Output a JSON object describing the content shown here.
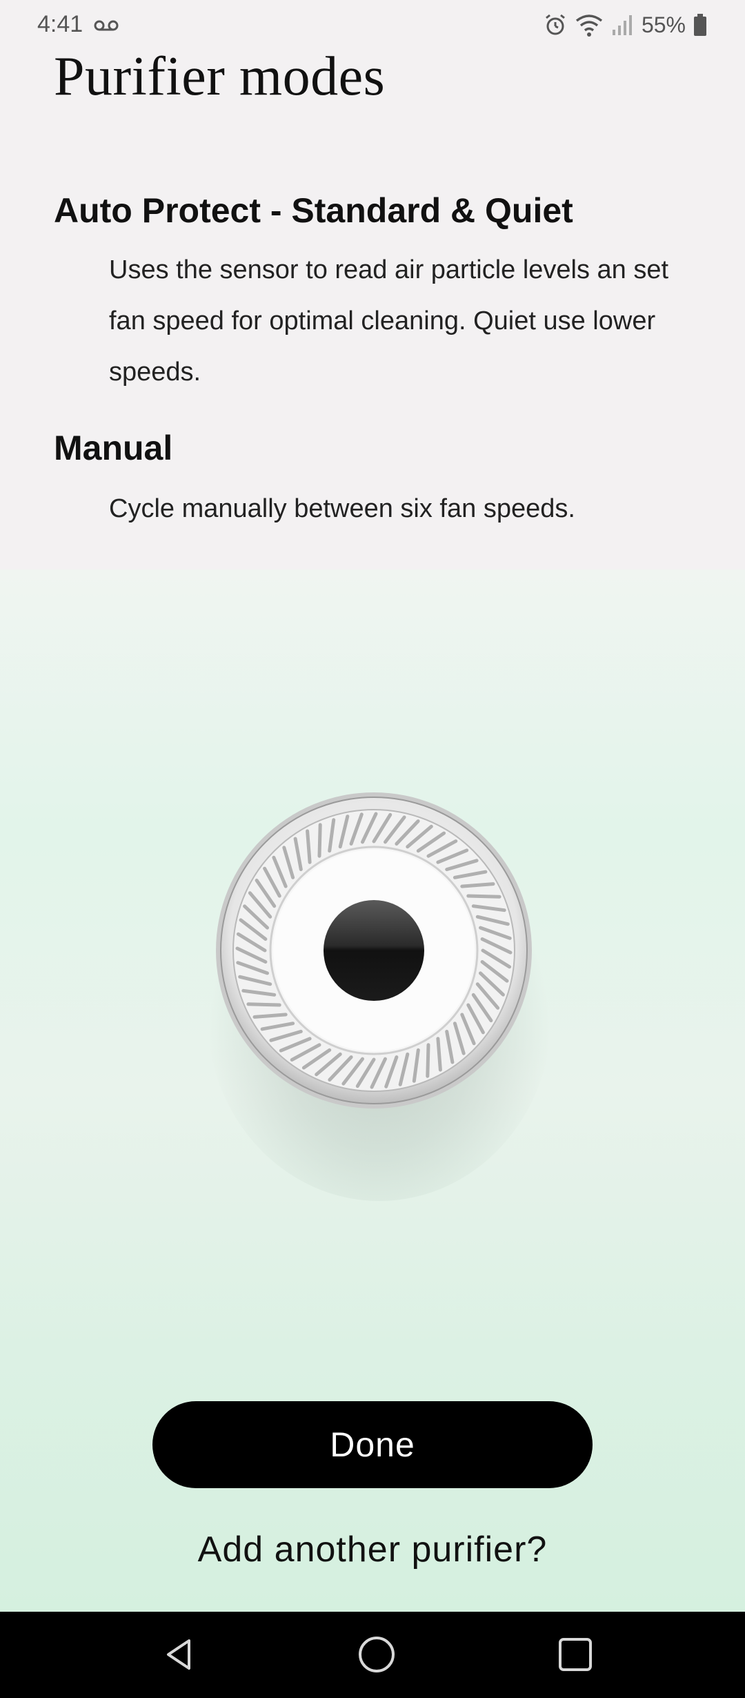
{
  "status_bar": {
    "time": "4:41",
    "battery": "55%",
    "icons": [
      "voicemail-icon",
      "alarm-icon",
      "wifi-icon",
      "signal-icon",
      "battery-icon"
    ]
  },
  "page": {
    "title": "Purifier modes"
  },
  "modes": [
    {
      "title": "Auto Protect - Standard & Quiet",
      "description": "Uses the sensor to read air particle levels an set fan speed for optimal cleaning. Quiet use lower speeds."
    },
    {
      "title": "Manual",
      "description": "Cycle manually between six fan speeds."
    }
  ],
  "actions": {
    "done_label": "Done",
    "add_label": "Add another purifier?"
  },
  "nav": {
    "icons": [
      "back-icon",
      "home-icon",
      "recents-icon"
    ]
  },
  "colors": {
    "top_background": "#f3f1f2",
    "bottom_background": "#d6f1e1",
    "button": "#000000",
    "button_text": "#ffffff"
  }
}
